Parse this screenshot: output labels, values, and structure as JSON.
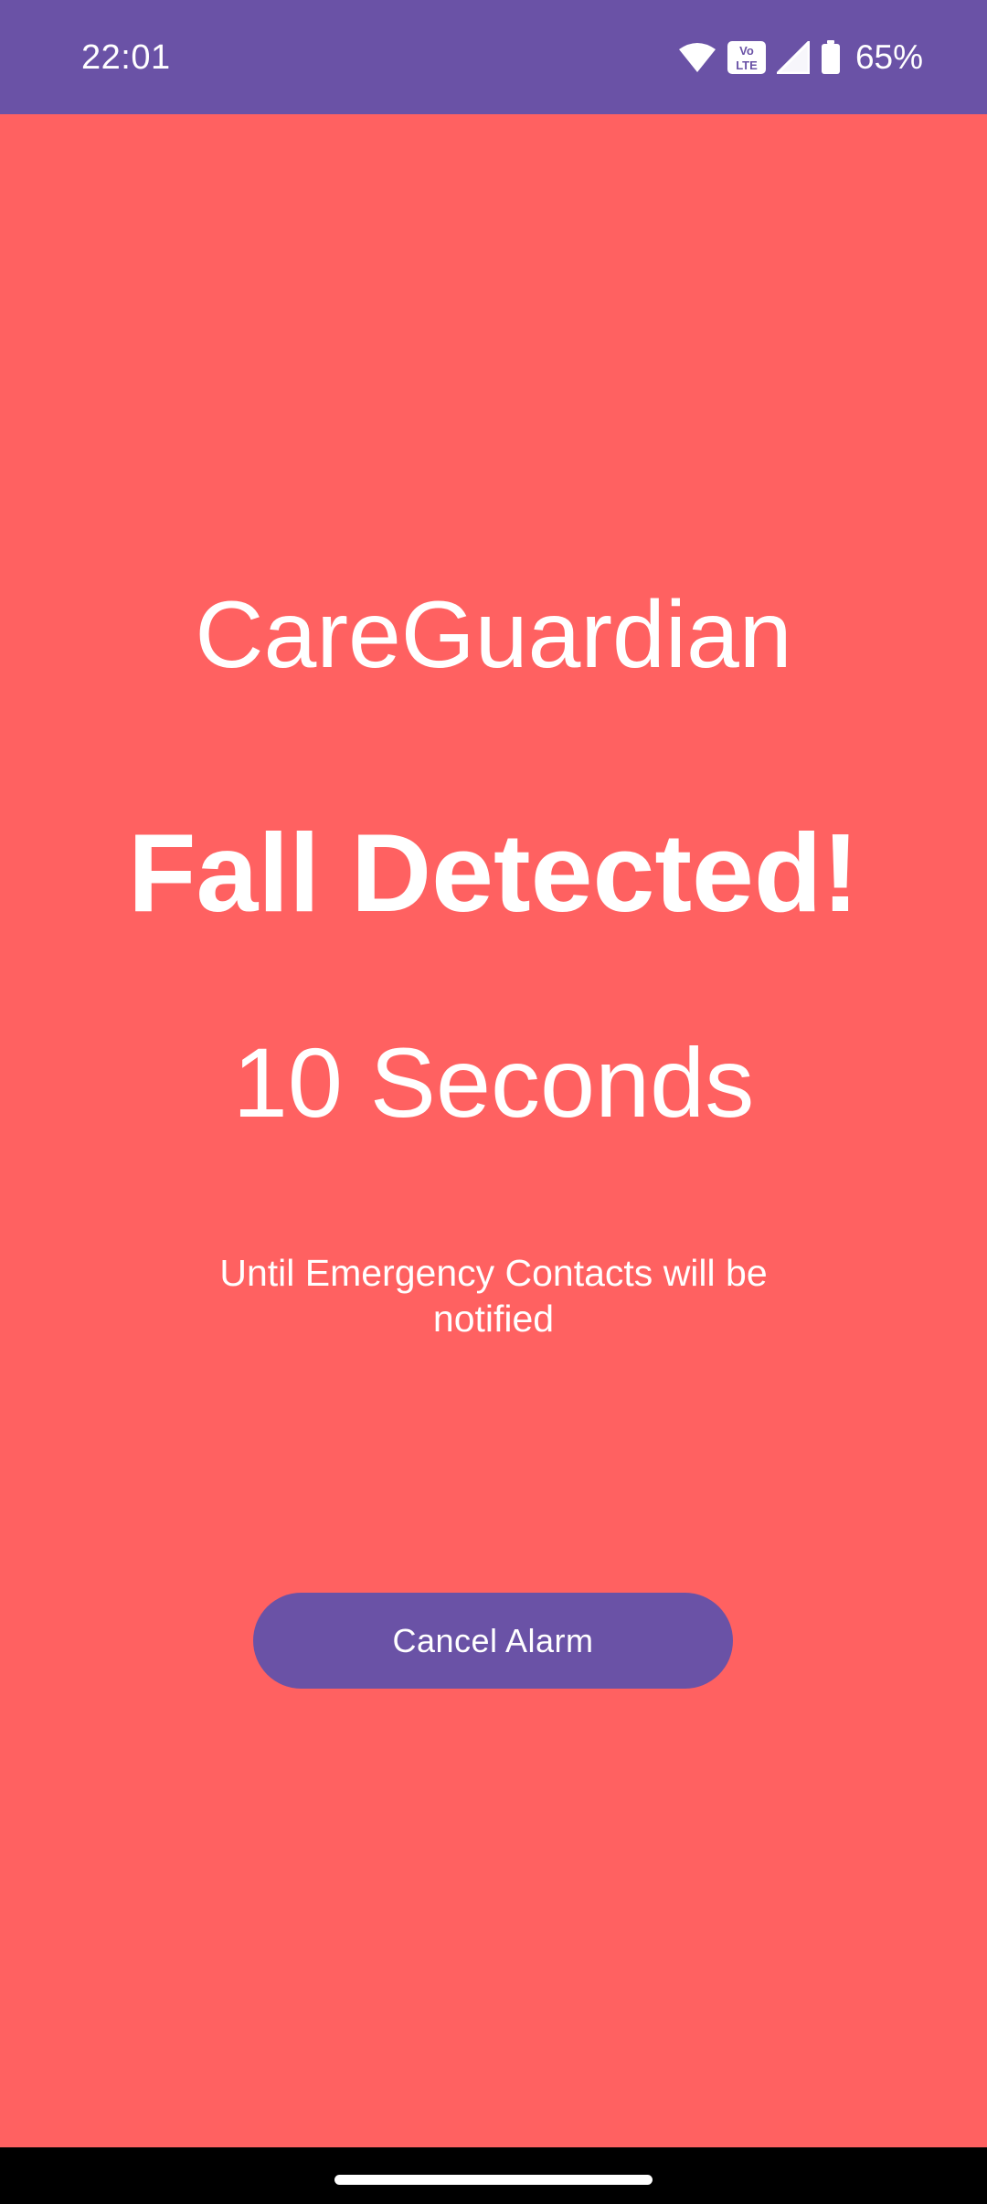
{
  "status_bar": {
    "time": "22:01",
    "volte_label": "Vo LTE",
    "battery_percent": "65%",
    "battery_level": 0.65,
    "icons": [
      "wifi-icon",
      "volte-icon",
      "cellular-signal-icon",
      "battery-icon"
    ]
  },
  "app": {
    "title": "CareGuardian"
  },
  "alert": {
    "heading": "Fall Detected!",
    "countdown": "10 Seconds",
    "message": "Until Emergency Contacts will be notified"
  },
  "actions": {
    "cancel_label": "Cancel Alarm"
  },
  "colors": {
    "background": "#FF6161",
    "accent": "#6A52A6",
    "text": "#FFFFFF"
  }
}
